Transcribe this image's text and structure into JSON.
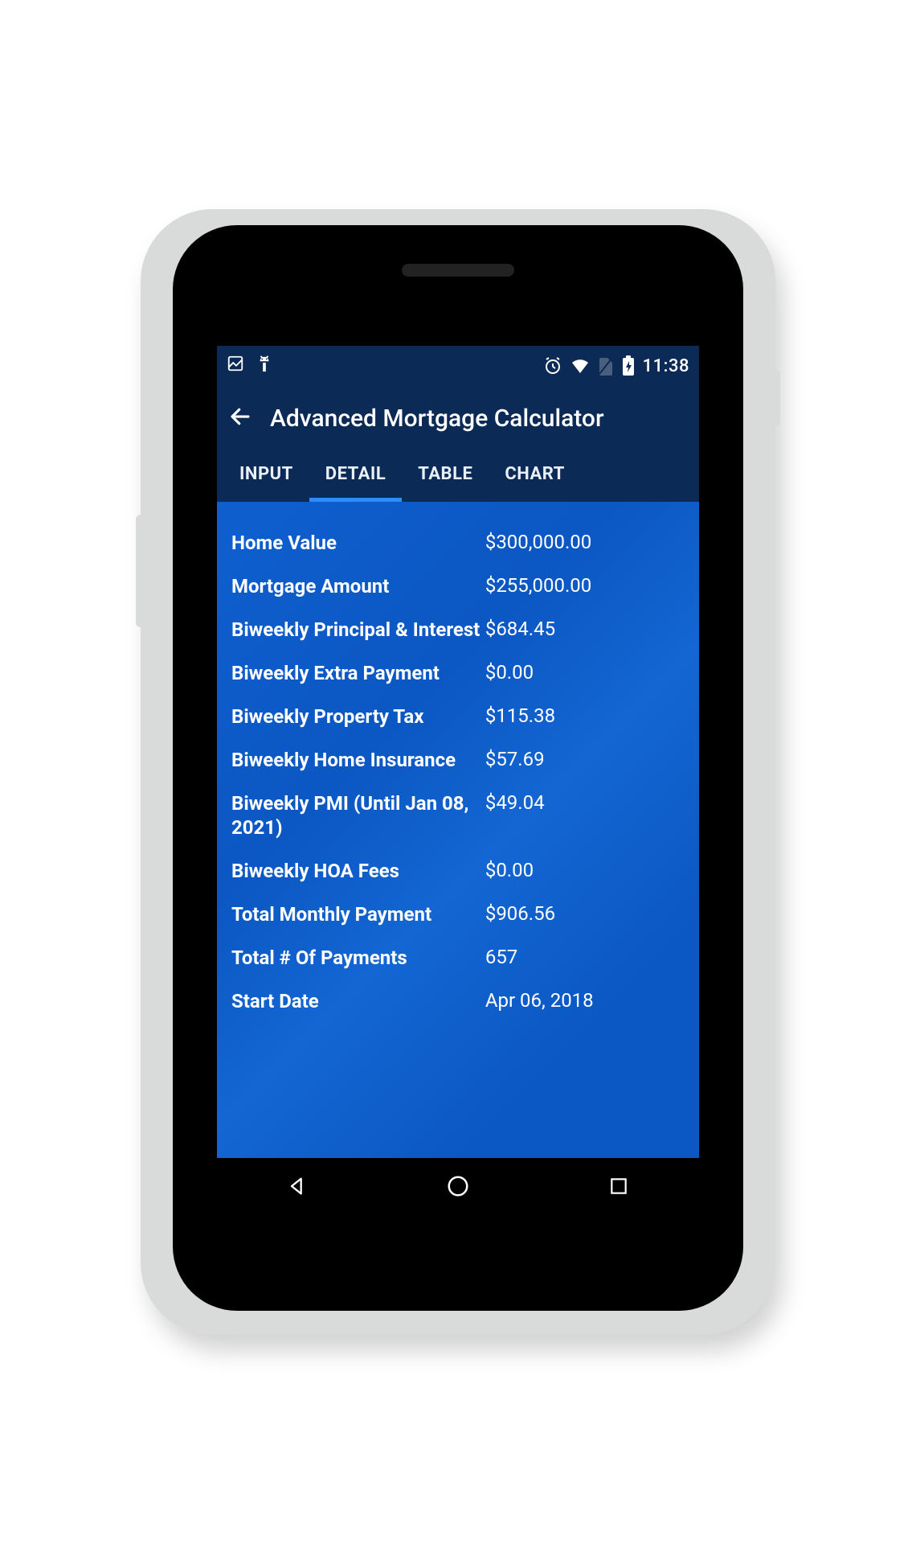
{
  "status": {
    "time": "11:38"
  },
  "header": {
    "title": "Advanced Mortgage Calculator"
  },
  "tabs": [
    {
      "label": "INPUT"
    },
    {
      "label": "DETAIL"
    },
    {
      "label": "TABLE"
    },
    {
      "label": "CHART"
    }
  ],
  "details": [
    {
      "label": "Home Value",
      "value": "$300,000.00"
    },
    {
      "label": "Mortgage Amount",
      "value": "$255,000.00"
    },
    {
      "label": "Biweekly Principal & Interest",
      "value": "$684.45"
    },
    {
      "label": "Biweekly Extra Payment",
      "value": "$0.00"
    },
    {
      "label": "Biweekly Property Tax",
      "value": "$115.38"
    },
    {
      "label": "Biweekly Home Insurance",
      "value": "$57.69"
    },
    {
      "label": "Biweekly PMI (Until Jan 08, 2021)",
      "value": "$49.04"
    },
    {
      "label": "Biweekly HOA Fees",
      "value": "$0.00"
    },
    {
      "label": "Total Monthly Payment",
      "value": "$906.56"
    },
    {
      "label": "Total # Of Payments",
      "value": "657"
    },
    {
      "label": "Start Date",
      "value": "Apr 06, 2018"
    }
  ]
}
